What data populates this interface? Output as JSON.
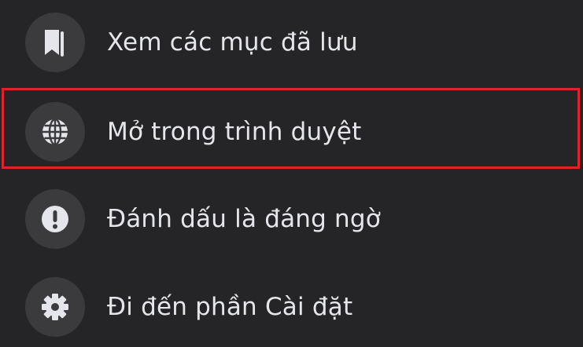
{
  "menu": {
    "items": [
      {
        "label": "Xem các mục đã lưu",
        "icon": "bookmark-icon"
      },
      {
        "label": "Mở trong trình duyệt",
        "icon": "globe-icon"
      },
      {
        "label": "Đánh dấu là đáng ngờ",
        "icon": "exclamation-icon"
      },
      {
        "label": "Đi đến phần Cài đặt",
        "icon": "gear-icon"
      }
    ],
    "highlighted_index": 1
  },
  "colors": {
    "background": "#252527",
    "icon_circle": "#3b3b3d",
    "text": "#e4e6eb",
    "icon": "#e4e6eb",
    "highlight_border": "#e0232a"
  }
}
